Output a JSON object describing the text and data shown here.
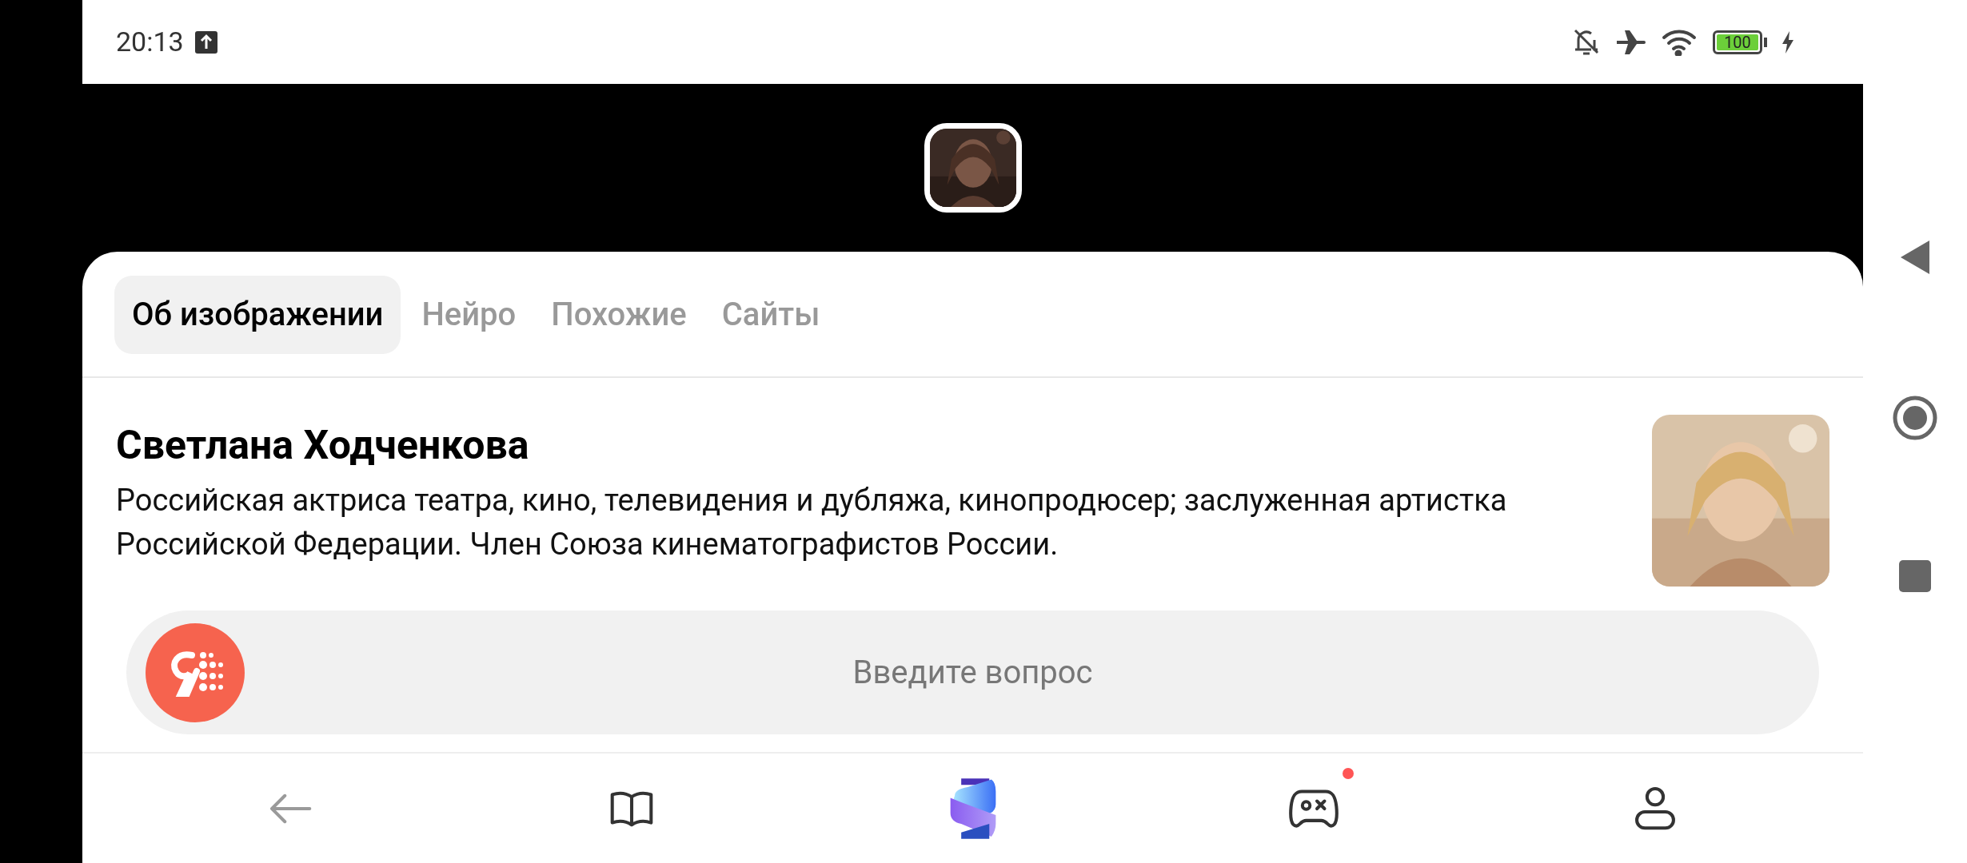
{
  "status_bar": {
    "time": "20:13",
    "battery": "100"
  },
  "tabs": [
    {
      "label": "Об изображении",
      "selected": true
    },
    {
      "label": "Нейро",
      "selected": false
    },
    {
      "label": "Похожие",
      "selected": false
    },
    {
      "label": "Сайты",
      "selected": false
    }
  ],
  "entity": {
    "title": "Светлана Ходченкова",
    "description": "Российская актриса театра, кино, телевидения и дубляжа, кинопродюсер; заслуженная артистка Российской Федерации. Член Союза кинематографистов России."
  },
  "search": {
    "placeholder": "Введите вопрос"
  },
  "bottom_nav": [
    {
      "kind": "back",
      "badge": false
    },
    {
      "kind": "book",
      "badge": false
    },
    {
      "kind": "logo",
      "badge": false
    },
    {
      "kind": "games",
      "badge": true
    },
    {
      "kind": "profile",
      "badge": false
    }
  ]
}
